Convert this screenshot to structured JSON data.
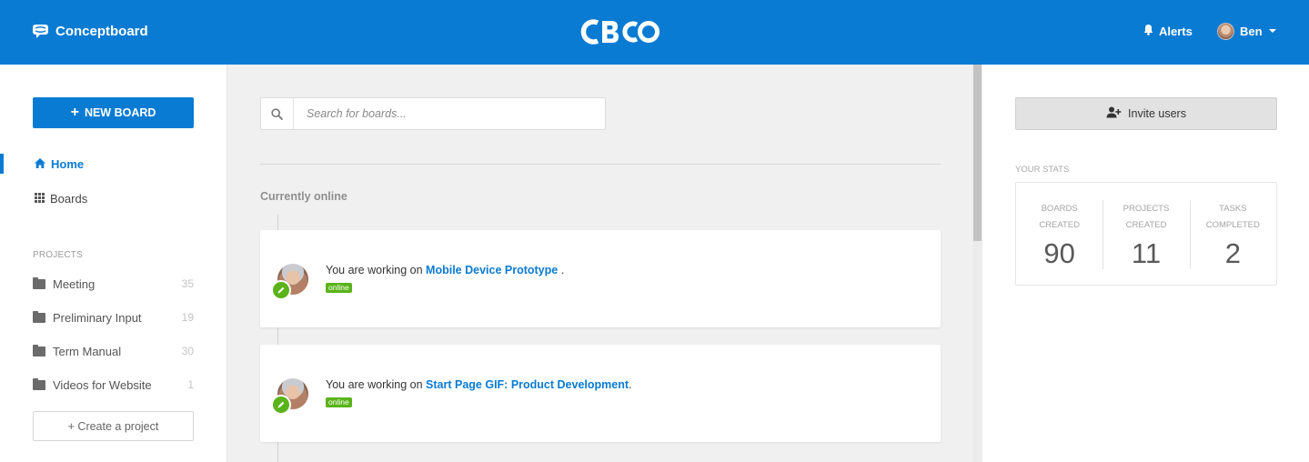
{
  "header": {
    "brand_name": "Conceptboard",
    "brand_icon": "speech-bubble-icon",
    "center_logo": "CBO",
    "alerts_label": "Alerts",
    "alerts_icon": "bell-icon",
    "user_name": "Ben",
    "bg_color": "#0a7bd3"
  },
  "sidebar": {
    "new_board_label": "NEW BOARD",
    "nav": [
      {
        "label": "Home",
        "icon": "home-icon",
        "active": true
      },
      {
        "label": "Boards",
        "icon": "grid-icon",
        "active": false
      }
    ],
    "projects_heading": "PROJECTS",
    "projects": [
      {
        "name": "Meeting",
        "count": "35"
      },
      {
        "name": "Preliminary Input",
        "count": "19"
      },
      {
        "name": "Term Manual",
        "count": "30"
      },
      {
        "name": "Videos for Website",
        "count": "1"
      }
    ],
    "create_project_label": "+ Create a project"
  },
  "main": {
    "search_placeholder": "Search for boards...",
    "section_title": "Currently online",
    "activity": [
      {
        "prefix": "You are working on",
        "board": "Mobile Device Prototype",
        "suffix": " .",
        "status": "online"
      },
      {
        "prefix": "You are working on",
        "board": "Start Page GIF: Product Development",
        "suffix": ".",
        "status": "online"
      }
    ]
  },
  "right": {
    "invite_label": "Invite users",
    "stats_heading": "YOUR STATS",
    "stats": [
      {
        "label_line1": "BOARDS",
        "label_line2": "CREATED",
        "value": "90"
      },
      {
        "label_line1": "PROJECTS",
        "label_line2": "CREATED",
        "value": "11"
      },
      {
        "label_line1": "TASKS",
        "label_line2": "COMPLETED",
        "value": "2"
      }
    ]
  },
  "colors": {
    "accent": "#0a7bd3",
    "online": "#5ab31a"
  }
}
